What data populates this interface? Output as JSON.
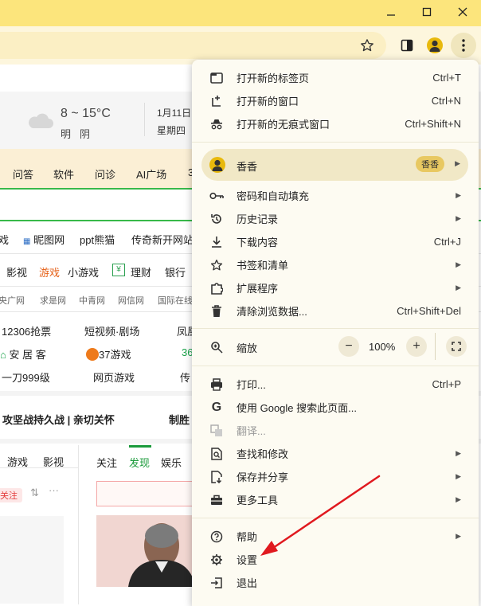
{
  "window": {
    "minimize_icon": "minimize-icon",
    "maximize_icon": "maximize-icon",
    "close_icon": "close-icon"
  },
  "toolbar": {
    "bookmark_icon": "star-icon",
    "sidepanel_icon": "side-panel-icon",
    "profile_icon": "avatar-icon",
    "menu_icon": "kebab-menu-icon"
  },
  "page": {
    "weather": {
      "temp": "8 ~ 15°C",
      "cond_day": "明",
      "cond_night": "阴",
      "date": "1月11日",
      "weekday": "星期四"
    },
    "nav": [
      "问答",
      "软件",
      "问诊",
      "AI广场",
      "3"
    ],
    "links_row1": [
      "戏",
      "昵图网",
      "ppt熊猫",
      "传奇新开网站"
    ],
    "links_row2": [
      "影视",
      "游戏",
      "小游戏",
      "理财",
      "银行"
    ],
    "links_row3": [
      "央广网",
      "求是网",
      "中青网",
      "网信网",
      "国际在线"
    ],
    "grid": [
      [
        "12306抢票",
        "短视频·剧场",
        "凤凰"
      ],
      [
        "安 居 客",
        "37游戏",
        "36"
      ],
      [
        "一刀999级",
        "网页游戏",
        "传"
      ]
    ],
    "headline": "攻坚战持久战 | 亲切关怀",
    "headline2": "制胜",
    "tabs_left": [
      "游戏",
      "影视"
    ],
    "tabs_right": [
      "关注",
      "发现",
      "娱乐"
    ],
    "follow_badge": "关注"
  },
  "menu": {
    "new_tab": {
      "label": "打开新的标签页",
      "shortcut": "Ctrl+T"
    },
    "new_window": {
      "label": "打开新的窗口",
      "shortcut": "Ctrl+N"
    },
    "incognito": {
      "label": "打开新的无痕式窗口",
      "shortcut": "Ctrl+Shift+N"
    },
    "profile": {
      "name": "香香",
      "badge": "香香"
    },
    "passwords": {
      "label": "密码和自动填充"
    },
    "history": {
      "label": "历史记录"
    },
    "downloads": {
      "label": "下载内容",
      "shortcut": "Ctrl+J"
    },
    "bookmarks": {
      "label": "书签和清单"
    },
    "extensions": {
      "label": "扩展程序"
    },
    "clear_data": {
      "label": "清除浏览数据...",
      "shortcut": "Ctrl+Shift+Del"
    },
    "zoom": {
      "label": "缩放",
      "minus": "−",
      "value": "100%",
      "plus": "+"
    },
    "print": {
      "label": "打印...",
      "shortcut": "Ctrl+P"
    },
    "google_search": {
      "label": "使用 Google 搜索此页面..."
    },
    "translate": {
      "label": "翻译..."
    },
    "find": {
      "label": "查找和修改"
    },
    "save_share": {
      "label": "保存并分享"
    },
    "more_tools": {
      "label": "更多工具"
    },
    "help": {
      "label": "帮助"
    },
    "settings": {
      "label": "设置"
    },
    "exit": {
      "label": "退出"
    }
  },
  "annotation": {
    "arrow_color": "#e0191f"
  }
}
